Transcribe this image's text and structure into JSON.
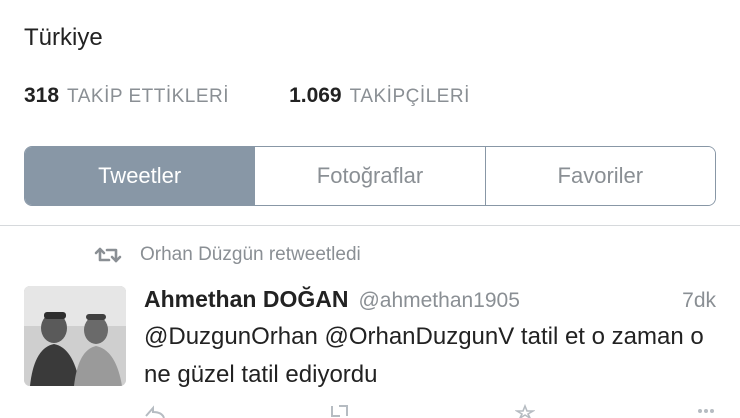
{
  "profile": {
    "location": "Türkiye",
    "stats": [
      {
        "number": "318",
        "label": "TAKİP ETTİKLERİ"
      },
      {
        "number": "1.069",
        "label": "TAKİPÇİLERİ"
      }
    ]
  },
  "tabs": [
    {
      "label": "Tweetler",
      "active": true
    },
    {
      "label": "Fotoğraflar",
      "active": false
    },
    {
      "label": "Favoriler",
      "active": false
    }
  ],
  "tweet": {
    "retweet_by": "Orhan Düzgün retweetledi",
    "author_name": "Ahmethan DOĞAN",
    "author_handle": "@ahmethan1905",
    "time": "7dk",
    "text": "@DuzgunOrhan @OrhanDuzgunV tatil et o zaman o ne güzel tatil ediyordu"
  },
  "colors": {
    "accent": "#8897a6",
    "muted_text": "#8a8f94",
    "divider": "#d6d9dc"
  },
  "icons": {
    "retweet": "retweet-icon",
    "avatar": "avatar"
  }
}
